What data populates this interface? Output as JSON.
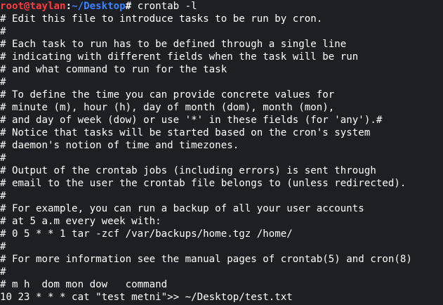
{
  "prompt": {
    "user_host": "root@taylan",
    "separator": ":",
    "path": "~/Desktop",
    "symbol": "# ",
    "command": "crontab -l"
  },
  "output_lines": [
    "# Edit this file to introduce tasks to be run by cron.",
    "#",
    "# Each task to run has to be defined through a single line",
    "# indicating with different fields when the task will be run",
    "# and what command to run for the task",
    "#",
    "# To define the time you can provide concrete values for",
    "# minute (m), hour (h), day of month (dom), month (mon),",
    "# and day of week (dow) or use '*' in these fields (for 'any').#",
    "# Notice that tasks will be started based on the cron's system",
    "# daemon's notion of time and timezones.",
    "#",
    "# Output of the crontab jobs (including errors) is sent through",
    "# email to the user the crontab file belongs to (unless redirected).",
    "#",
    "# For example, you can run a backup of all your user accounts",
    "# at 5 a.m every week with:",
    "# 0 5 * * 1 tar -zcf /var/backups/home.tgz /home/",
    "#",
    "# For more information see the manual pages of crontab(5) and cron(8)",
    "#",
    "# m h  dom mon dow   command",
    "10 23 * * * cat \"test metni\">> ~/Desktop/test.txt"
  ]
}
